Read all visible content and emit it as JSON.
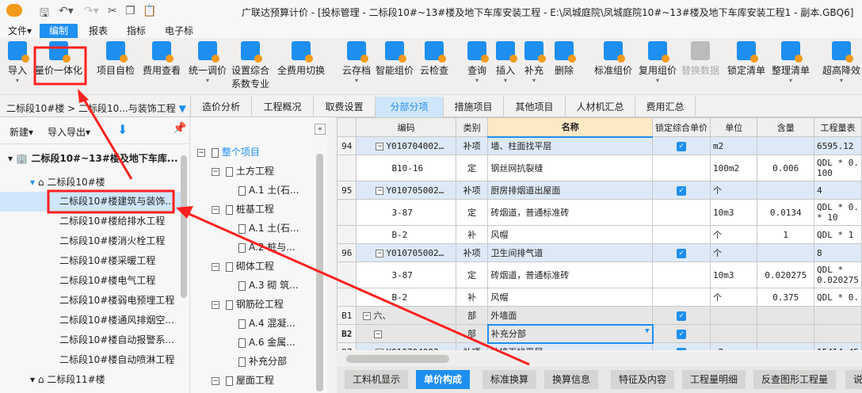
{
  "window": {
    "title": "广联达预算计价 - [投标管理 - 二标段10#~13#楼及地下车库安装工程 - E:\\凤城庭院\\凤城庭院10#~13#楼及地下车库安装工程1 - 副本.GBQ6]"
  },
  "menu": [
    "文件▾",
    "编制",
    "报表",
    "指标",
    "电子标"
  ],
  "ribbon": [
    "导入",
    "量价一体化",
    "项目自检",
    "费用查看",
    "统一调价",
    "设置综合\n系数专业",
    "全费用切换",
    "云存档",
    "智能组价",
    "云检查",
    "查询",
    "插入",
    "补充",
    "删除",
    "标准组价",
    "复用组价",
    "替换数据",
    "锁定清单",
    "整理清单",
    "超高降效"
  ],
  "breadcrumb": "二标段10#楼 > 二标段10...与装饰工程",
  "tabs": [
    "造价分析",
    "工程概况",
    "取费设置",
    "分部分项",
    "措施项目",
    "其他项目",
    "人材机汇总",
    "费用汇总"
  ],
  "left": {
    "new": "新建",
    "import_export": "导入导出",
    "tree": [
      "二标段10#~13#楼及地下车库...",
      "二标段10#楼",
      "二标段10#楼建筑与装饰...",
      "二标段10#楼给排水工程",
      "二标段10#楼消火栓工程",
      "二标段10#楼采暖工程",
      "二标段10#楼电气工程",
      "二标段10#楼弱电预埋工程",
      "二标段10#楼通风排烟空...",
      "二标段10#楼自动报警系...",
      "二标段10#楼自动喷淋工程",
      "二标段11#楼"
    ]
  },
  "mid": {
    "tree": [
      "整个项目",
      "土方工程",
      "A.1  土(石...",
      "桩基工程",
      "A.1  土(石...",
      "A.2  桩与...",
      "砌体工程",
      "A.3  砌 筑...",
      "钢筋砼工程",
      "A.4  混凝...",
      "A.6  金属...",
      "补充分部",
      "屋面工程"
    ]
  },
  "grid": {
    "headers": [
      "",
      "编码",
      "类别",
      "名称",
      "锁定综合单价",
      "单位",
      "含量",
      "工程量表"
    ],
    "rows": [
      {
        "no": "94",
        "code": "Y010704002…",
        "type": "补项",
        "name": "墙、柱面找平层",
        "lock": true,
        "unit": "m2",
        "qty": "",
        "expr": "6595.12",
        "kind": "item"
      },
      {
        "no": "",
        "code": "B10-16",
        "type": "定",
        "name": "钢丝网抗裂缝",
        "lock": false,
        "unit": "100m2",
        "qty": "0.006",
        "expr": "QDL * 0.\n100",
        "kind": "sub"
      },
      {
        "no": "95",
        "code": "Y010705002…",
        "type": "补项",
        "name": "厨房排烟道出屋面",
        "lock": true,
        "unit": "个",
        "qty": "",
        "expr": "4",
        "kind": "item"
      },
      {
        "no": "",
        "code": "3-87",
        "type": "定",
        "name": "砖烟道，普通标准砖",
        "lock": false,
        "unit": "10m3",
        "qty": "0.0134",
        "expr": "QDL * 0.\n* 10",
        "kind": "sub"
      },
      {
        "no": "",
        "code": "B-2",
        "type": "补",
        "name": "风帽",
        "lock": false,
        "unit": "个",
        "qty": "1",
        "expr": "QDL * 1",
        "kind": "sub"
      },
      {
        "no": "96",
        "code": "Y010705002…",
        "type": "补项",
        "name": "卫生间排气道",
        "lock": true,
        "unit": "个",
        "qty": "",
        "expr": "8",
        "kind": "item"
      },
      {
        "no": "",
        "code": "3-87",
        "type": "定",
        "name": "砖烟道，普通标准砖",
        "lock": false,
        "unit": "10m3",
        "qty": "0.020275",
        "expr": "QDL *\n0.020275",
        "kind": "sub"
      },
      {
        "no": "",
        "code": "B-2",
        "type": "补",
        "name": "风帽",
        "lock": false,
        "unit": "个",
        "qty": "0.375",
        "expr": "QDL * 0.",
        "kind": "sub"
      },
      {
        "no": "B1",
        "code": "六、",
        "type": "部",
        "name": "外墙面",
        "lock": true,
        "unit": "",
        "qty": "",
        "expr": "",
        "kind": "part"
      },
      {
        "no": "B2",
        "code": "",
        "type": "部",
        "name": "补充分部",
        "lock": true,
        "unit": "",
        "qty": "",
        "expr": "",
        "kind": "part"
      },
      {
        "no": "97",
        "code": "Y010704002…",
        "type": "补项",
        "name": "外墙面找平层",
        "lock": true,
        "unit": "m2",
        "qty": "",
        "expr": "15414.45",
        "kind": "item"
      }
    ]
  },
  "bottom_tabs": [
    "工料机显示",
    "单价构成",
    "标准换算",
    "换算信息",
    "特征及内容",
    "工程量明细",
    "反查图形工程量",
    "说"
  ],
  "colors": {
    "accent": "#1e8ff0",
    "highlight": "#ff2020"
  }
}
